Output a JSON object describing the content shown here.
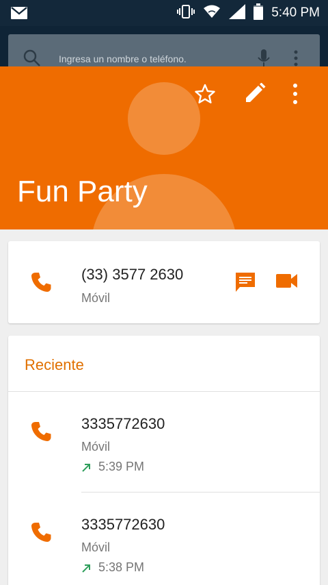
{
  "status_bar": {
    "time": "5:40 PM"
  },
  "search": {
    "placeholder": "Ingresa un nombre o teléfono."
  },
  "contact": {
    "name": "Fun Party",
    "phone": "(33) 3577 2630",
    "phone_type": "Móvil"
  },
  "recent": {
    "title": "Reciente",
    "entries": [
      {
        "number": "3335772630",
        "type": "Móvil",
        "time": "5:39 PM",
        "call_direction": "outgoing"
      },
      {
        "number": "3335772630",
        "type": "Móvil",
        "time": "5:38 PM",
        "call_direction": "outgoing"
      }
    ]
  },
  "colors": {
    "accent": "#ef6c00",
    "status_bar": "#13283a",
    "outgoing_arrow": "#2e9e5b"
  }
}
